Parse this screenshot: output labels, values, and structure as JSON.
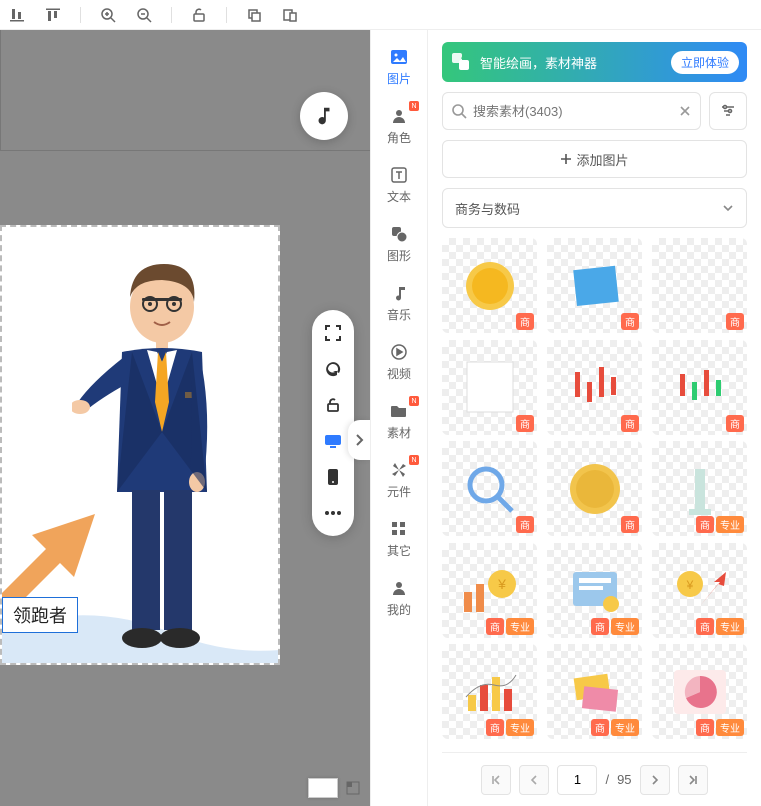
{
  "topbar": {
    "tools": [
      "align-left",
      "align-right",
      "zoom-in",
      "zoom-out",
      "lock",
      "copy",
      "paste"
    ]
  },
  "canvas": {
    "caption": "领跑者"
  },
  "sidenav": {
    "items": [
      {
        "key": "image",
        "label": "图片",
        "icon": "image",
        "active": true
      },
      {
        "key": "character",
        "label": "角色",
        "icon": "person",
        "badge": "N"
      },
      {
        "key": "text",
        "label": "文本",
        "icon": "text"
      },
      {
        "key": "shape",
        "label": "图形",
        "icon": "shape"
      },
      {
        "key": "music",
        "label": "音乐",
        "icon": "music"
      },
      {
        "key": "video",
        "label": "视频",
        "icon": "play"
      },
      {
        "key": "assets",
        "label": "素材",
        "icon": "folder",
        "badge": "N"
      },
      {
        "key": "widget",
        "label": "元件",
        "icon": "pinwheel",
        "badge": "N"
      },
      {
        "key": "other",
        "label": "其它",
        "icon": "grid"
      },
      {
        "key": "mine",
        "label": "我的",
        "icon": "user"
      }
    ]
  },
  "promo": {
    "text": "智能绘画，素材神器",
    "cta": "立即体验"
  },
  "search": {
    "placeholder": "搜索素材(3403)"
  },
  "addImage": {
    "label": "添加图片"
  },
  "category": {
    "selected": "商务与数码"
  },
  "assets": [
    {
      "name": "gold-coin",
      "tags": [
        "商"
      ]
    },
    {
      "name": "blue-note",
      "tags": [
        "商"
      ]
    },
    {
      "name": "blank",
      "tags": [
        "商"
      ]
    },
    {
      "name": "white-card",
      "tags": [
        "商"
      ]
    },
    {
      "name": "candlestick-red",
      "tags": [
        "商"
      ]
    },
    {
      "name": "candlestick-mixed",
      "tags": [
        "商"
      ]
    },
    {
      "name": "magnifier",
      "tags": [
        "商"
      ]
    },
    {
      "name": "coin-flat",
      "tags": [
        "商"
      ]
    },
    {
      "name": "pillar",
      "tags": [
        "商",
        "专业"
      ]
    },
    {
      "name": "coins-chart",
      "tags": [
        "商",
        "专业"
      ]
    },
    {
      "name": "receipt",
      "tags": [
        "商",
        "专业"
      ]
    },
    {
      "name": "coin-arrow",
      "tags": [
        "商",
        "专业"
      ]
    },
    {
      "name": "bar-chart",
      "tags": [
        "商",
        "专业"
      ]
    },
    {
      "name": "tickets",
      "tags": [
        "商",
        "专业"
      ]
    },
    {
      "name": "pie-chart",
      "tags": [
        "商",
        "专业"
      ]
    }
  ],
  "pager": {
    "current": "1",
    "total": "95",
    "sep": "/"
  }
}
